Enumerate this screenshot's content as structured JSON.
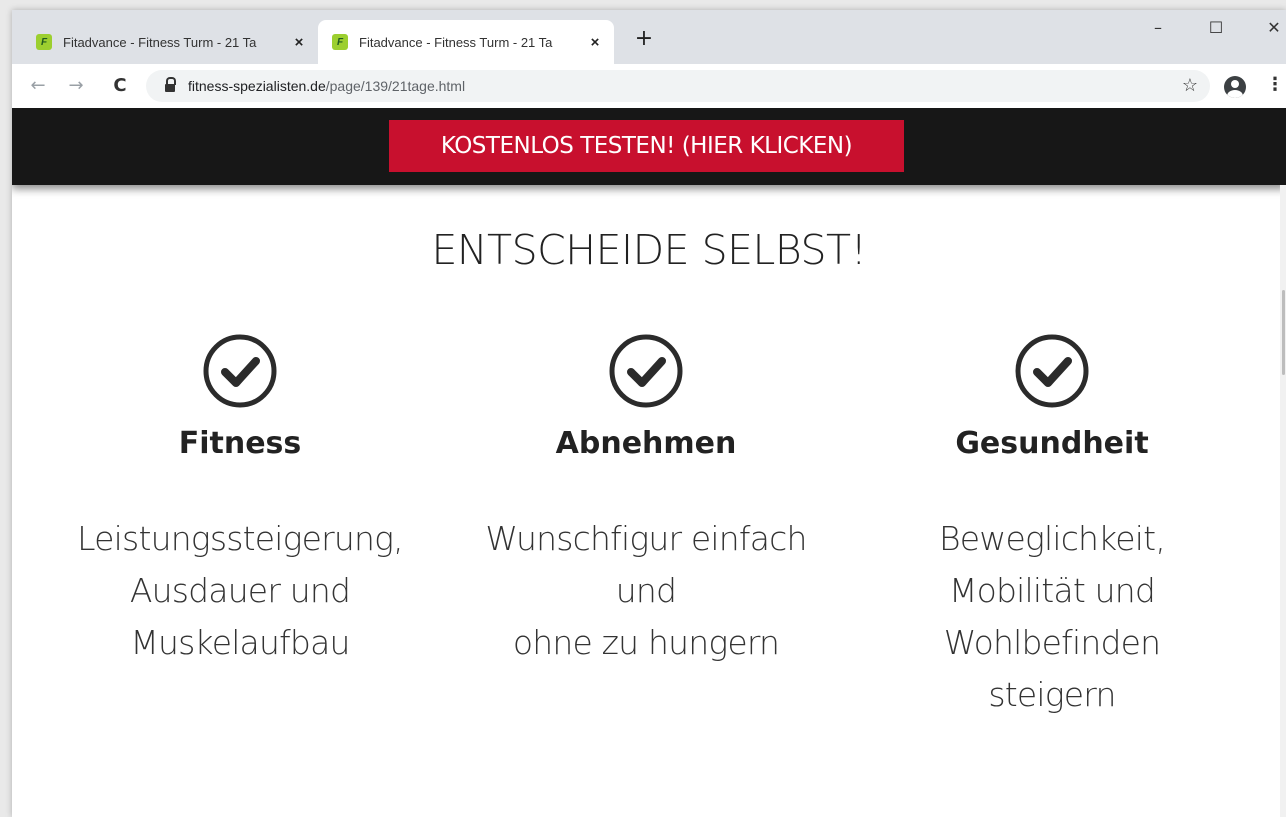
{
  "browser": {
    "tabs": [
      {
        "favicon": "F",
        "title": "Fitadvance - Fitness Turm - 21 Ta",
        "close": "×"
      },
      {
        "favicon": "F",
        "title": "Fitadvance - Fitness Turm - 21 Ta",
        "close": "×"
      }
    ],
    "new_tab": "+",
    "window_controls": {
      "minimize": "–",
      "maximize": "☐",
      "close": "✕"
    },
    "nav": {
      "back": "←",
      "forward": "→",
      "reload": "C"
    },
    "url": {
      "host": "fitness-spezialisten.de",
      "path": "/page/139/21tage.html"
    },
    "bookmark_icon": "☆",
    "menu": "⋮"
  },
  "page": {
    "cta_label": "KOSTENLOS TESTEN! (HIER KLICKEN)",
    "heading": "ENTSCHEIDE SELBST!",
    "columns": [
      {
        "title": "Fitness",
        "lines": [
          "Leistungssteigerung,",
          "Ausdauer und",
          "Muskelaufbau"
        ]
      },
      {
        "title": "Abnehmen",
        "lines": [
          "Wunschfigur einfach",
          "und",
          "ohne zu hungern"
        ]
      },
      {
        "title": "Gesundheit",
        "lines": [
          "Beweglichkeit,",
          "Mobilität und",
          "Wohlbefinden",
          "steigern"
        ]
      }
    ],
    "colors": {
      "cta": "#c8102e",
      "topbar": "#171717",
      "favicon": "#9ccf2f"
    }
  }
}
